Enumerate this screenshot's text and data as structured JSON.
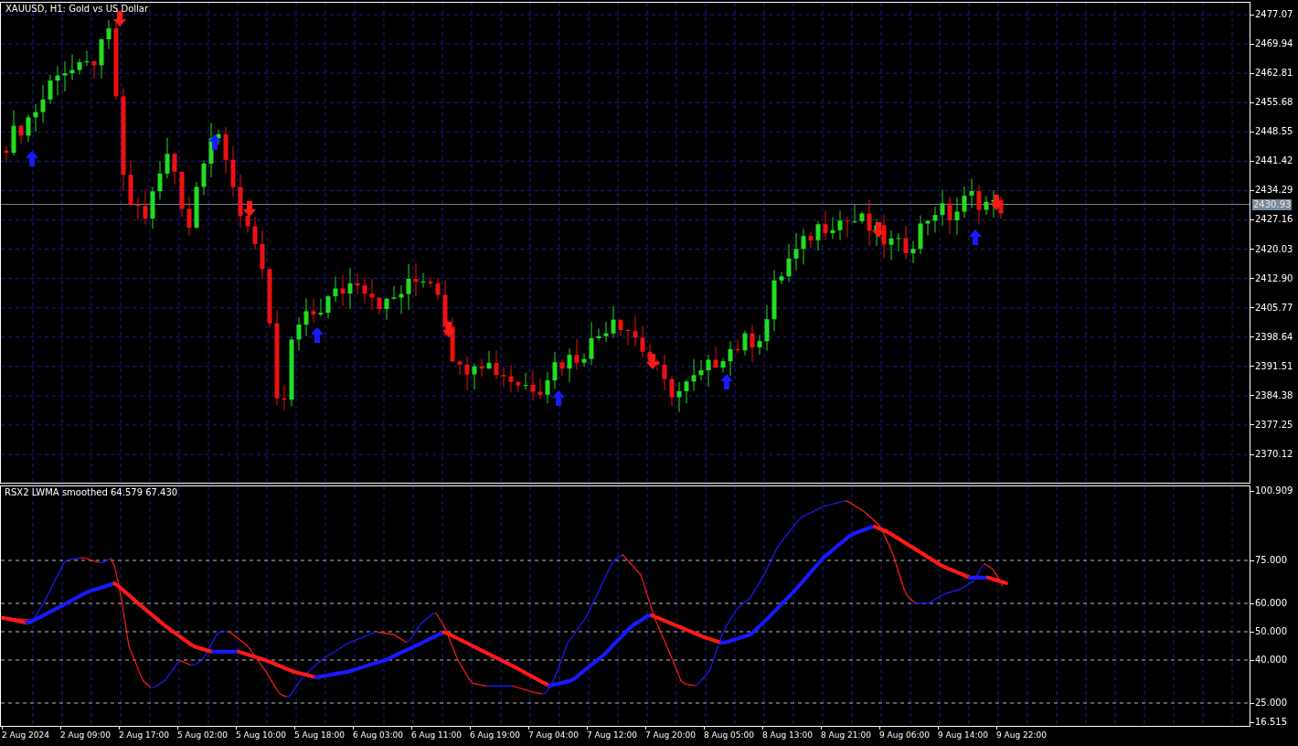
{
  "price_chart": {
    "title": "XAUUSD, H1:  Gold vs US Dollar",
    "price_axis": [
      "2477.07",
      "2469.94",
      "2462.81",
      "2455.68",
      "2448.55",
      "2441.42",
      "2434.29",
      "2427.16",
      "2420.03",
      "2412.90",
      "2405.77",
      "2398.64",
      "2391.51",
      "2384.38",
      "2377.25",
      "2370.12"
    ],
    "current_price": "2430.93"
  },
  "indicator": {
    "title": "RSX2 LWMA smoothed  64.579 67.430",
    "axis": [
      "100.909",
      "75.000",
      "60.000",
      "50.000",
      "40.000",
      "25.000",
      "16.515"
    ]
  },
  "time_axis": [
    "2 Aug 2024",
    "2 Aug 09:00",
    "2 Aug 17:00",
    "5 Aug 02:00",
    "5 Aug 10:00",
    "5 Aug 18:00",
    "6 Aug 03:00",
    "6 Aug 11:00",
    "6 Aug 19:00",
    "7 Aug 04:00",
    "7 Aug 12:00",
    "7 Aug 20:00",
    "8 Aug 05:00",
    "8 Aug 13:00",
    "8 Aug 21:00",
    "9 Aug 06:00",
    "9 Aug 14:00",
    "9 Aug 22:00"
  ]
}
